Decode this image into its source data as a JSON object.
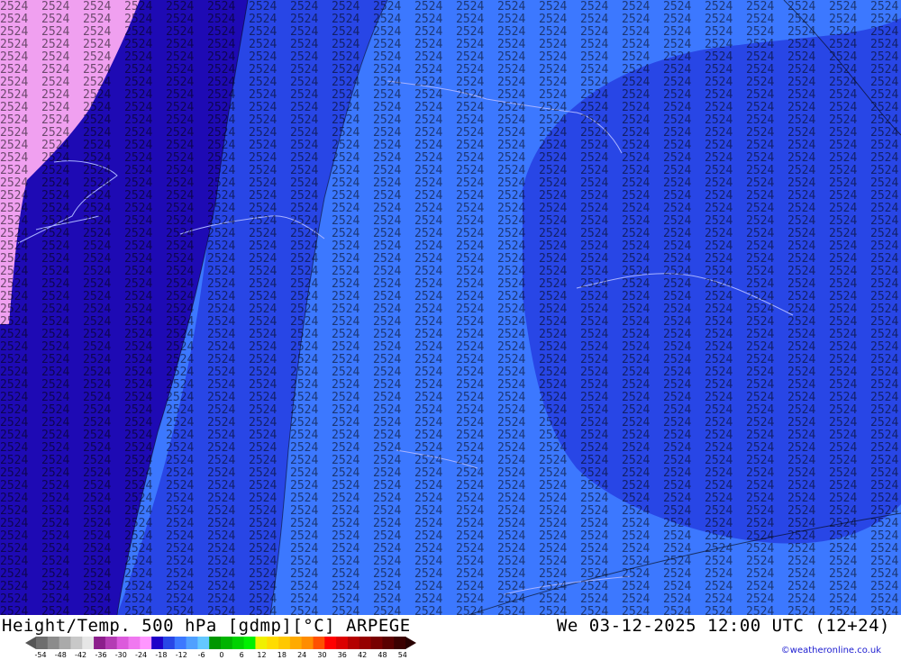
{
  "header": {
    "title_left": "Height/Temp. 500 hPa [gdmp][°C] ARPEGE",
    "title_right": "We 03-12-2025 12:00 UTC (12+24)"
  },
  "legend": {
    "labels": [
      "-54",
      "-48",
      "-42",
      "-36",
      "-30",
      "-24",
      "-18",
      "-12",
      "-6",
      "0",
      "6",
      "12",
      "18",
      "24",
      "30",
      "36",
      "42",
      "48",
      "54"
    ],
    "colors": [
      "#6e6e6e",
      "#8c8c8c",
      "#aaaaaa",
      "#c8c8c8",
      "#e6e6e6",
      "#8c1e8c",
      "#b43cb4",
      "#dc5adc",
      "#f078f0",
      "#ff96ff",
      "#1e00c8",
      "#2846e6",
      "#3c78ff",
      "#50a0ff",
      "#64c8ff",
      "#009600",
      "#00b400",
      "#00d200",
      "#00f000",
      "#f0f000",
      "#ffdc00",
      "#ffc800",
      "#ffaa00",
      "#ff8c00",
      "#ff5000",
      "#ff0000",
      "#dc0000",
      "#b40000",
      "#960000",
      "#780000",
      "#5a0000",
      "#3c0000"
    ]
  },
  "credit": "©weatheronline.co.uk",
  "map": {
    "description_colors": {
      "pink": "#f0a0f0",
      "deep_blue": "#1e0ab4",
      "mid_blue": "#2846e6",
      "light_blue": "#3c78ff",
      "contour": "#000000",
      "coast": "#aab4ff"
    }
  }
}
